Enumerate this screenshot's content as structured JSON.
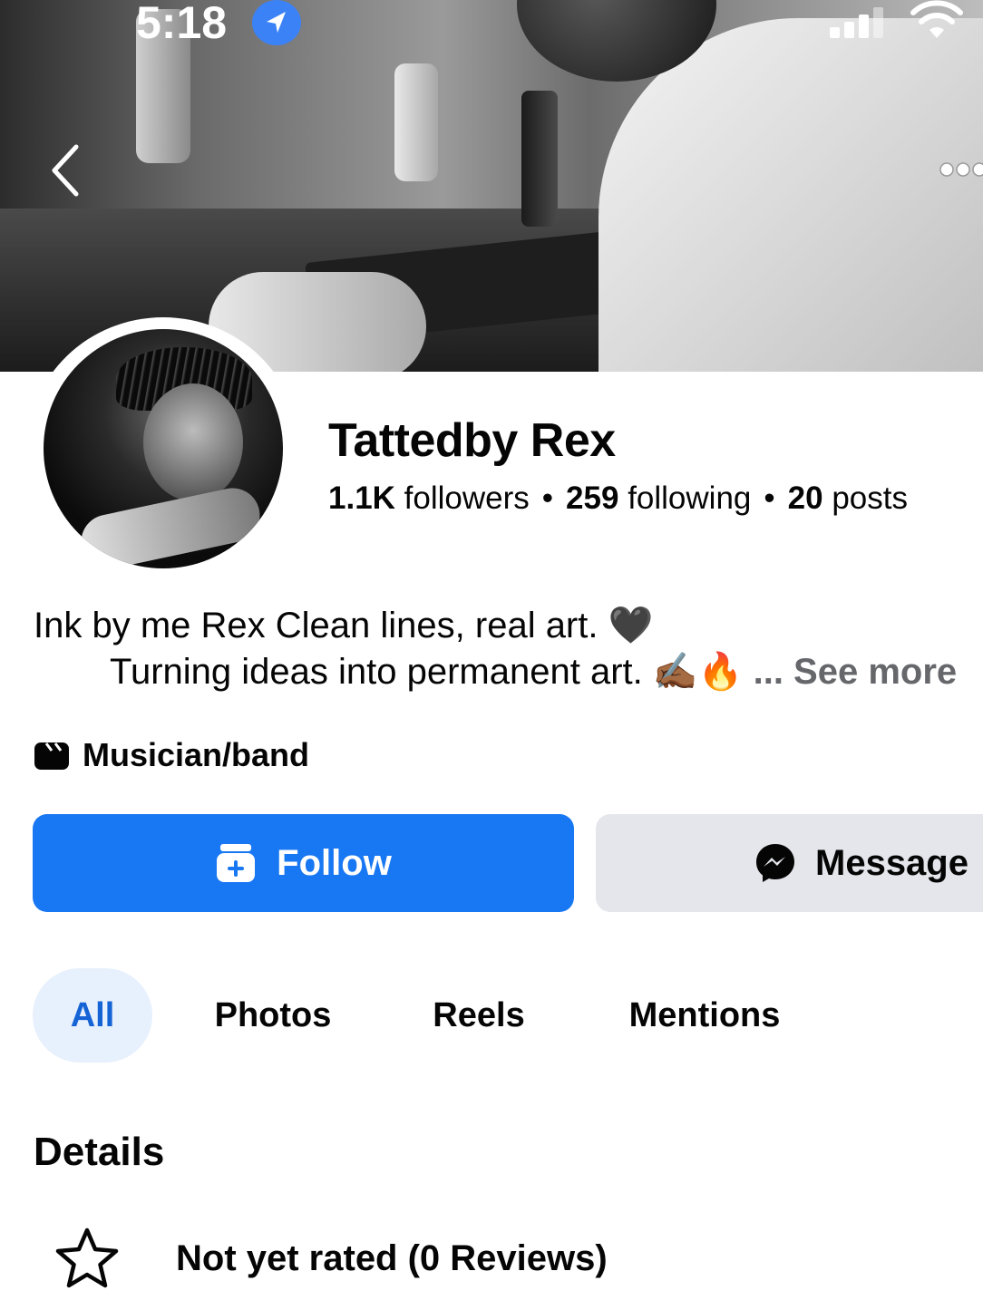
{
  "status_bar": {
    "time": "5:18",
    "icons": [
      "location-arrow-icon",
      "cellular-signal-icon",
      "wifi-icon"
    ]
  },
  "navigation": {
    "back_icon": "chevron-left-icon",
    "more_icon": "ellipsis-icon"
  },
  "profile": {
    "name": "Tattedby Rex",
    "followers_count": "1.1K",
    "followers_label": "followers",
    "following_count": "259",
    "following_label": "following",
    "posts_count": "20",
    "posts_label": "posts",
    "separator": "•",
    "bio_line1": "Ink by me Rex Clean lines, real art. 🖤",
    "bio_line2": "Turning ideas into permanent art. ✍🏾🔥",
    "see_more": "... See more",
    "category": "Musician/band"
  },
  "actions": {
    "follow_label": "Follow",
    "message_label": "Message"
  },
  "tabs": [
    {
      "label": "All",
      "active": true
    },
    {
      "label": "Photos",
      "active": false
    },
    {
      "label": "Reels",
      "active": false
    },
    {
      "label": "Mentions",
      "active": false
    }
  ],
  "details": {
    "heading": "Details",
    "rating_text": "Not yet rated (0 Reviews)"
  },
  "colors": {
    "primary": "#1877f2",
    "tab_active_bg": "#e7f0fd",
    "tab_active_text": "#1464d6",
    "secondary_button_bg": "#e4e6eb"
  }
}
